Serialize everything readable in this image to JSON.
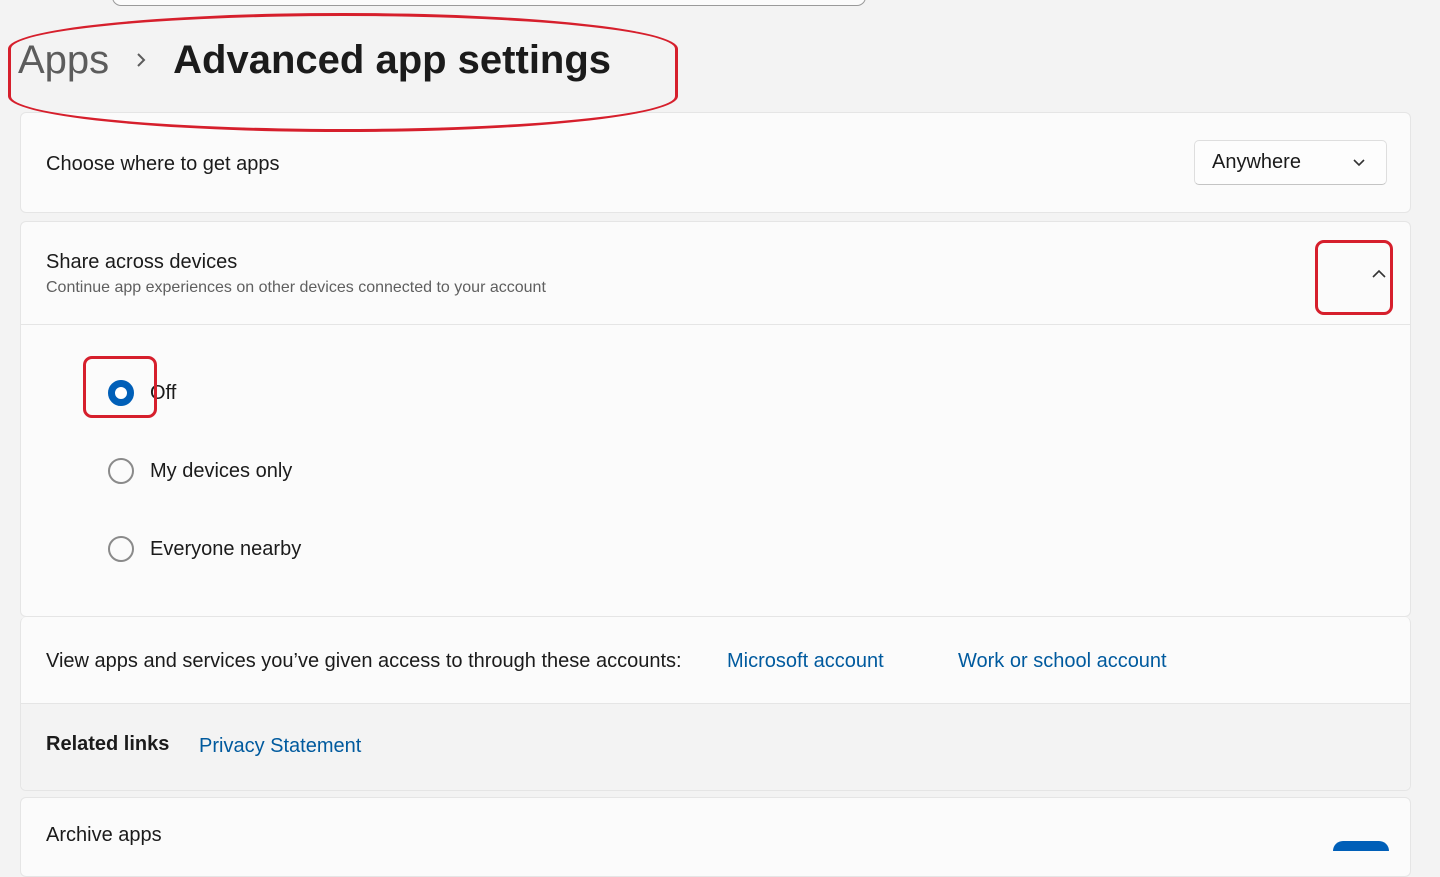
{
  "breadcrumb": {
    "parent": "Apps",
    "current": "Advanced app settings"
  },
  "choose_where": {
    "label": "Choose where to get apps",
    "selected": "Anywhere"
  },
  "share": {
    "title": "Share across devices",
    "subtitle": "Continue app experiences on other devices connected to your account",
    "options": [
      {
        "label": "Off",
        "checked": true
      },
      {
        "label": "My devices only",
        "checked": false
      },
      {
        "label": "Everyone nearby",
        "checked": false
      }
    ]
  },
  "accounts": {
    "label": "View apps and services you’ve given access to through these accounts:",
    "microsoft": "Microsoft account",
    "work": "Work or school account"
  },
  "related": {
    "label": "Related links",
    "privacy": "Privacy Statement"
  },
  "archive": {
    "label": "Archive apps"
  },
  "colors": {
    "accent": "#005fb8",
    "link": "#005a9e",
    "annotation": "#d61f2c"
  },
  "icons": [
    "chevron-right-icon",
    "chevron-down-icon",
    "chevron-up-icon"
  ]
}
